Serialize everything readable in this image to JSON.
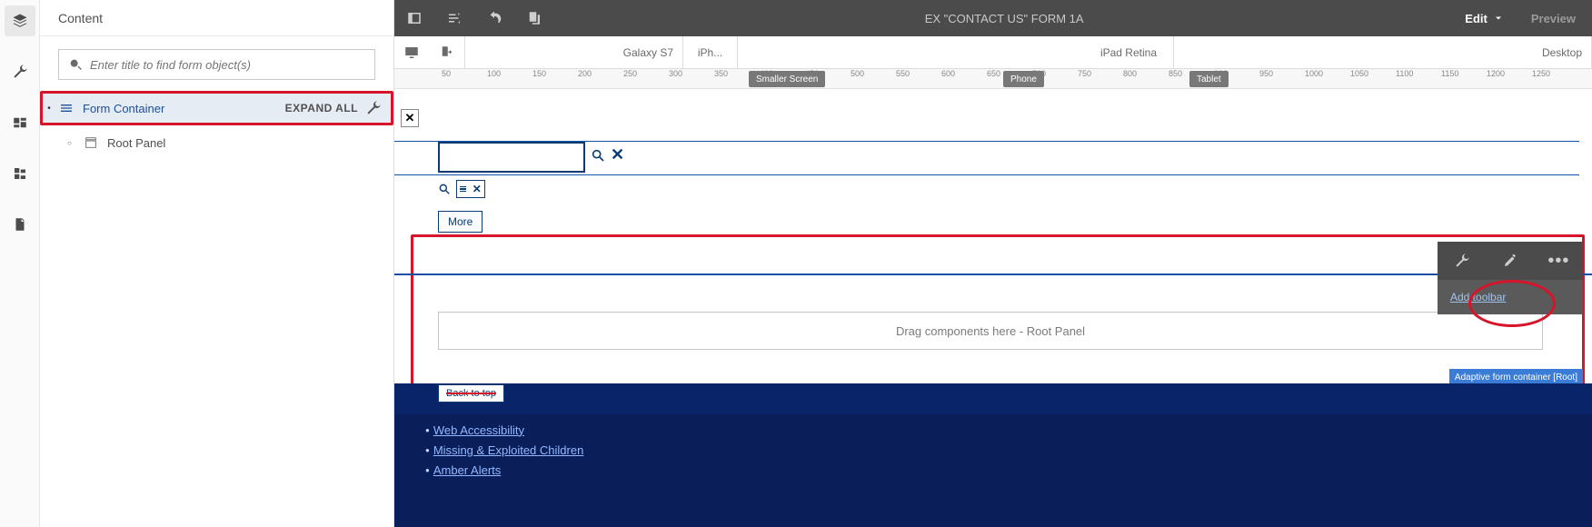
{
  "panel": {
    "title": "Content",
    "search_placeholder": "Enter title to find form object(s)",
    "tree": {
      "form_container_label": "Form Container",
      "expand_all": "EXPAND ALL",
      "root_panel_label": "Root Panel"
    }
  },
  "topbar": {
    "title": "EX \"CONTACT US\" FORM 1A",
    "edit": "Edit",
    "preview": "Preview"
  },
  "devices": {
    "galaxy_s7": "Galaxy S7",
    "iphone": "iPh...",
    "ipad_retina": "iPad Retina",
    "desktop": "Desktop"
  },
  "ruler": {
    "ticks": [
      50,
      100,
      150,
      200,
      250,
      300,
      350,
      400,
      450,
      500,
      550,
      600,
      650,
      700,
      750,
      800,
      850,
      900,
      950,
      1000,
      1050,
      1100,
      1150,
      1200,
      1250
    ],
    "chips": {
      "smaller_screen": "Smaller Screen",
      "phone": "Phone",
      "tablet": "Tablet"
    },
    "chip_positions": {
      "smaller_screen": 390,
      "phone": 670,
      "tablet": 875
    }
  },
  "canvas": {
    "more": "More",
    "drop_placeholder": "Drag components here - Root Panel",
    "add_toolbar": "Add toolbar",
    "afc_badge": "Adaptive form container [Root]",
    "back_to_top": "Back to top",
    "links": [
      "Web Accessibility",
      "Missing & Exploited Children",
      "Amber Alerts"
    ]
  }
}
